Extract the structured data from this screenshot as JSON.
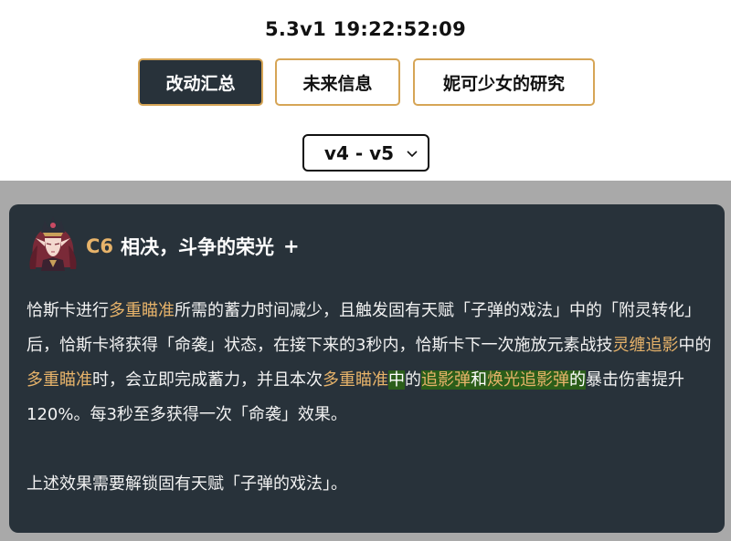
{
  "header": {
    "version_time": "5.3v1 19:22:52:09"
  },
  "nav": {
    "changes": "改动汇总",
    "future": "未来信息",
    "research": "妮可少女的研究"
  },
  "version_select": {
    "value": "v4 - v5"
  },
  "card": {
    "level": "C6",
    "title": "相决，斗争的荣光",
    "expand": "+",
    "p1": {
      "t1": "恰斯卡进行",
      "k1": "多重瞄准",
      "t2": "所需的蓄力时间减少，且触发固有天赋「子弹的戏法」中的「附灵转化」后，恰斯卡将获得「命袭」状态，在接下来的3秒内，恰斯卡下一次施放元素战技",
      "k2": "灵缠追影",
      "t3": "中的",
      "k3": "多重瞄准",
      "t4": "时，会立即完成蓄力，并且本次",
      "k4": "多重瞄准",
      "k5": "中",
      "t5": "的",
      "k6": "追影弹",
      "t6": "和",
      "k7": "焕光追影弹",
      "t7": "的",
      "t8": "暴击伤害提升120%。每3秒至多获得一次「命袭」效果。"
    },
    "p2": "上述效果需要解锁固有天赋「子弹的戏法」。"
  },
  "colors": {
    "accent": "#d6a556",
    "keyword": "#e7b36a",
    "card_bg": "#28323a",
    "highlight_bg": "#2b5e1a"
  }
}
